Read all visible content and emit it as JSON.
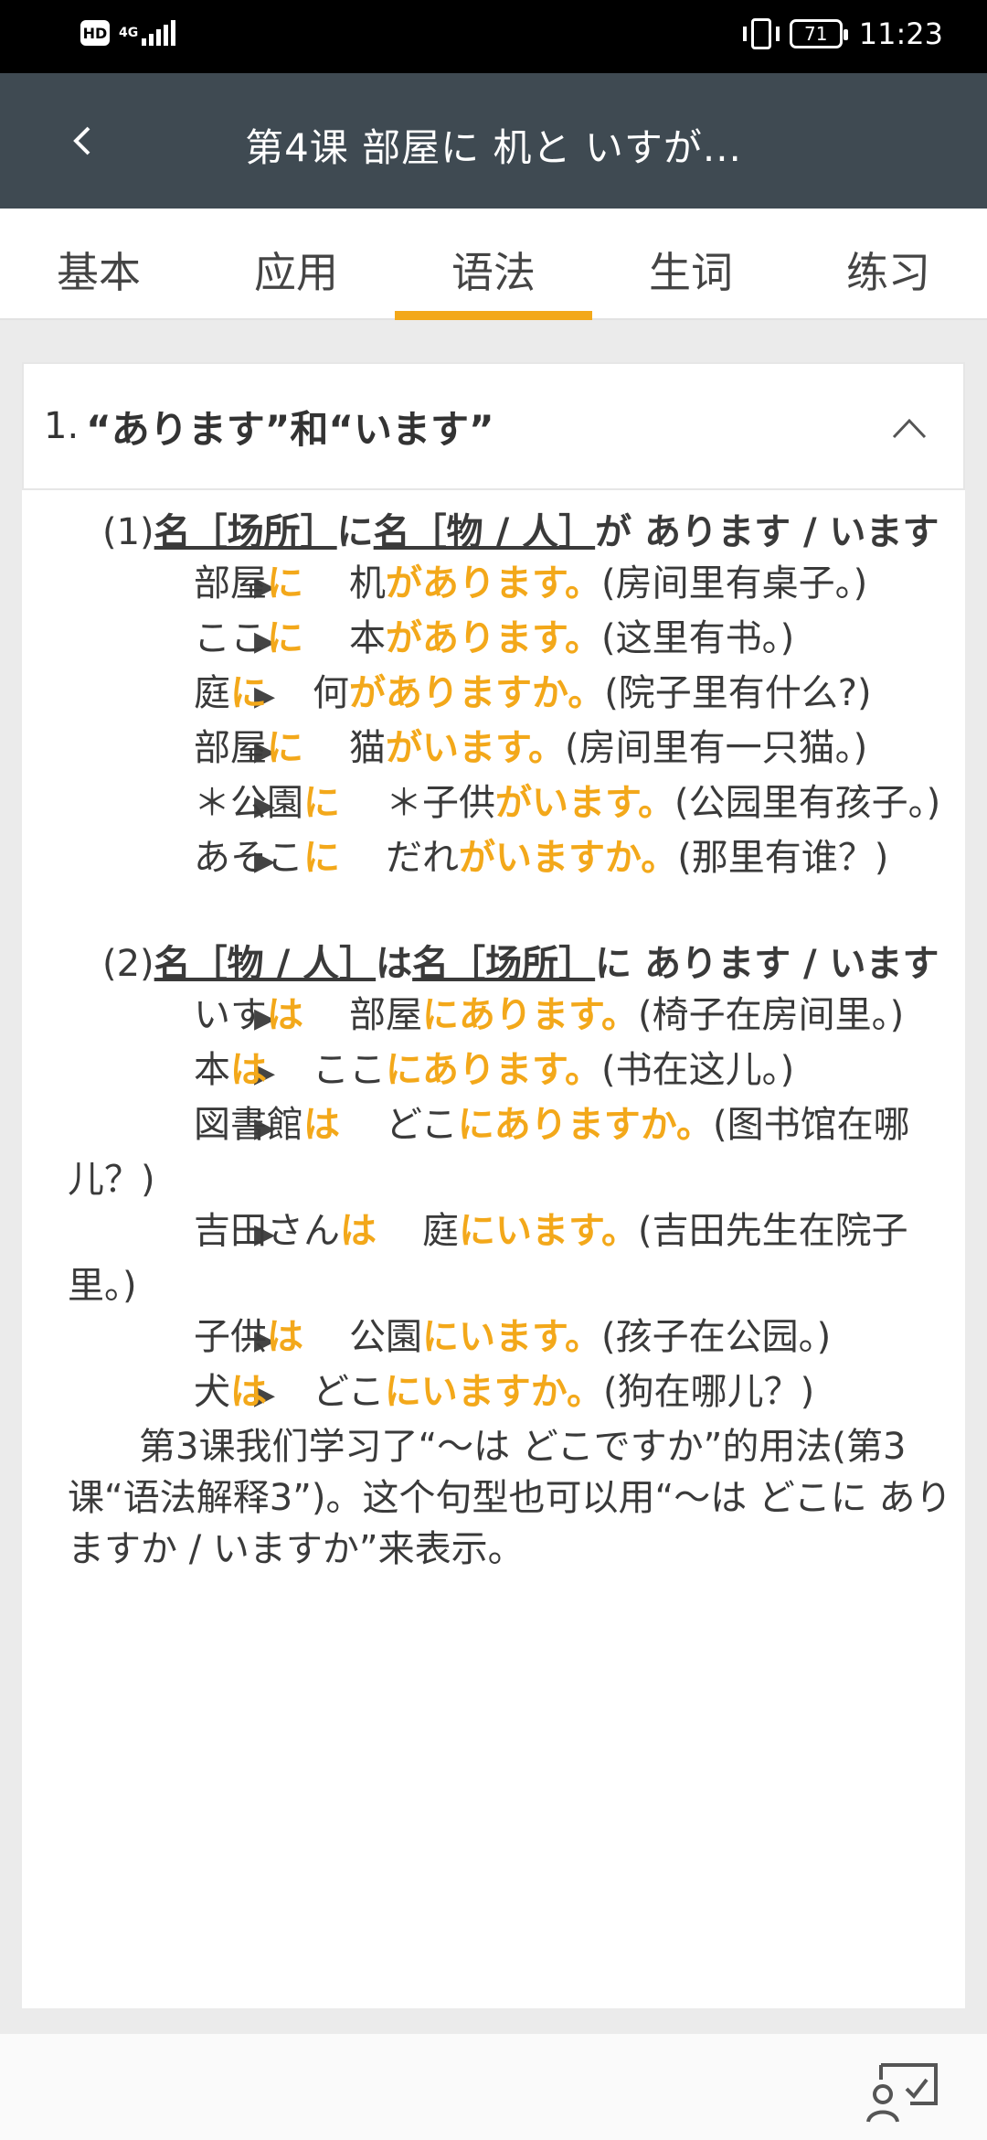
{
  "status": {
    "network": "4G",
    "hd": "HD",
    "battery": "71",
    "time": "11:23"
  },
  "appbar": {
    "title": "第4课 部屋に  机と  いすが..."
  },
  "tabs": [
    "基本",
    "应用",
    "语法",
    "生词",
    "练习"
  ],
  "section": {
    "number": "1.",
    "title": "“あります”和“います”"
  },
  "pattern1": {
    "num": "(1)",
    "p1": "名［场所］",
    "p2": "に",
    "p3": "名［物 / 人］",
    "p4": "が あります / います"
  },
  "examples1": [
    {
      "a": "部屋",
      "b": "に",
      "c": "机",
      "d": "があります。",
      "e": "(房间里有桌子。)"
    },
    {
      "a": "ここ",
      "b": "に",
      "c": "本",
      "d": "があります。",
      "e": "(这里有书。)"
    },
    {
      "a": "庭",
      "b": "に",
      "c": "何",
      "d": "がありますか。",
      "e": "(院子里有什么?)"
    },
    {
      "a": "部屋",
      "b": "に",
      "c": "猫",
      "d": "がいます。",
      "e": "(房间里有一只猫。)"
    },
    {
      "a": "＊公園",
      "b": "に",
      "c": "＊子供",
      "d": "がいます。",
      "e": "(公园里有孩子。)"
    },
    {
      "a": "あそこ",
      "b": "に",
      "c": "だれ",
      "d": "がいますか。",
      "e": "(那里有谁？)"
    }
  ],
  "pattern2": {
    "num": "(2)",
    "p1": "名［物 / 人］",
    "p2": "は",
    "p3": "名［场所］",
    "p4": "に あります / います"
  },
  "examples2": [
    {
      "a": "いす",
      "b": "は",
      "c": "部屋",
      "d": "にあります。",
      "e": "(椅子在房间里。)"
    },
    {
      "a": "本",
      "b": "は",
      "c": "ここ",
      "d": "にあります。",
      "e": "(书在这儿。)"
    },
    {
      "a": "図書館",
      "b": "は",
      "c": "どこ",
      "d": "にありますか。",
      "e": "(图书馆在哪儿？)"
    },
    {
      "a": "吉田さん",
      "b": "は",
      "c": "庭",
      "d": "にいます。",
      "e": "(吉田先生在院子里。)"
    },
    {
      "a": "子供",
      "b": "は",
      "c": "公園",
      "d": "にいます。",
      "e": "(孩子在公园。)"
    },
    {
      "a": "犬",
      "b": "は",
      "c": "どこ",
      "d": "にいますか。",
      "e": "(狗在哪儿？)"
    }
  ],
  "note": "第3课我们学习了“～は どこですか”的用法(第3课“语法解释3”)。这个句型也可以用“～は どこに ありますか / いますか”来表示。",
  "icons": {
    "back": "back-arrow-icon",
    "collapse": "chevron-up-icon",
    "fab": "screen-cast-icon"
  },
  "colors": {
    "accent": "#f3a81a",
    "appbar": "#3f4a52"
  }
}
